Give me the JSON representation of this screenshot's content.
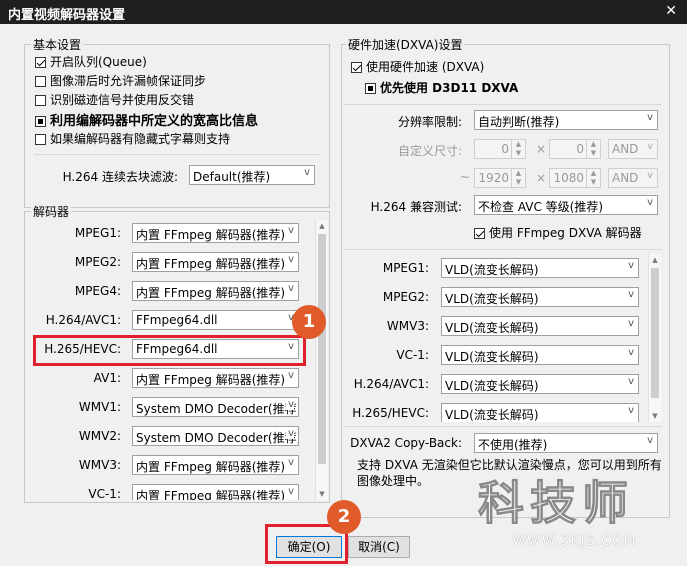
{
  "window": {
    "title": "内置视频解码器设置"
  },
  "basic": {
    "legend": "基本设置",
    "options": [
      {
        "label": "开启队列(Queue)",
        "state": "checked",
        "bold": false
      },
      {
        "label": "图像滞后时允许漏帧保证同步",
        "state": "unchecked",
        "bold": false
      },
      {
        "label": "识别磁迹信号并使用反交错",
        "state": "unchecked",
        "bold": false
      },
      {
        "label": "利用编解码器中所定义的宽高比信息",
        "state": "filled",
        "bold": true
      },
      {
        "label": "如果编解码器有隐藏式字幕则支持",
        "state": "unchecked",
        "bold": false
      }
    ],
    "deblock_label": "H.264 连续去块滤波:",
    "deblock_value": "Default(推荐)"
  },
  "decoders": {
    "legend": "解码器",
    "rows": [
      {
        "label": "MPEG1:",
        "value": "内置 FFmpeg 解码器(推荐)"
      },
      {
        "label": "MPEG2:",
        "value": "内置 FFmpeg 解码器(推荐)"
      },
      {
        "label": "MPEG4:",
        "value": "内置 FFmpeg 解码器(推荐)"
      },
      {
        "label": "H.264/AVC1:",
        "value": "FFmpeg64.dll"
      },
      {
        "label": "H.265/HEVC:",
        "value": "FFmpeg64.dll"
      },
      {
        "label": "AV1:",
        "value": "内置 FFmpeg 解码器(推荐)"
      },
      {
        "label": "WMV1:",
        "value": "System DMO Decoder(推荐)"
      },
      {
        "label": "WMV2:",
        "value": "System DMO Decoder(推荐)"
      },
      {
        "label": "WMV3:",
        "value": "内置 FFmpeg 解码器(推荐)"
      },
      {
        "label": "VC-1:",
        "value": "内置 FFmpeg 解码器(推荐)"
      }
    ]
  },
  "hw": {
    "legend": "硬件加速(DXVA)设置",
    "use_hw": "使用硬件加速 (DXVA)",
    "prefer_d3d11": "优先使用 D3D11 DXVA",
    "resolution_label": "分辨率限制:",
    "resolution_value": "自动判断(推荐)",
    "custom_label": "自定义尺寸:",
    "custom_w1": "0",
    "custom_h1": "0",
    "and1": "AND",
    "tilde": "~",
    "custom_w2": "1920",
    "custom_h2": "1080",
    "and2": "AND",
    "times": "×",
    "compat_label": "H.264 兼容测试:",
    "compat_value": "不检查 AVC 等级(推荐)",
    "use_ffmpeg_dxva": "使用 FFmpeg DXVA 解码器",
    "rows": [
      {
        "label": "MPEG1:",
        "value": "VLD(流变长解码)"
      },
      {
        "label": "MPEG2:",
        "value": "VLD(流变长解码)"
      },
      {
        "label": "WMV3:",
        "value": "VLD(流变长解码)"
      },
      {
        "label": "VC-1:",
        "value": "VLD(流变长解码)"
      },
      {
        "label": "H.264/AVC1:",
        "value": "VLD(流变长解码)"
      },
      {
        "label": "H.265/HEVC:",
        "value": "VLD(流变长解码)"
      }
    ],
    "copyback_label": "DXVA2 Copy-Back:",
    "copyback_value": "不使用(推荐)",
    "note": "支持 DXVA 无渲染但它比默认渲染慢点，您可以用到所有图像处理中。"
  },
  "buttons": {
    "ok": "确定(O)",
    "cancel": "取消(C)"
  },
  "badges": [
    "1",
    "2"
  ],
  "watermark": {
    "text": "科技师",
    "url": "WWW.3KJS.COM"
  },
  "colors": {
    "highlight": "#e0212b",
    "badge": "#e05a2a",
    "titlebar": "#1f1f1f"
  }
}
